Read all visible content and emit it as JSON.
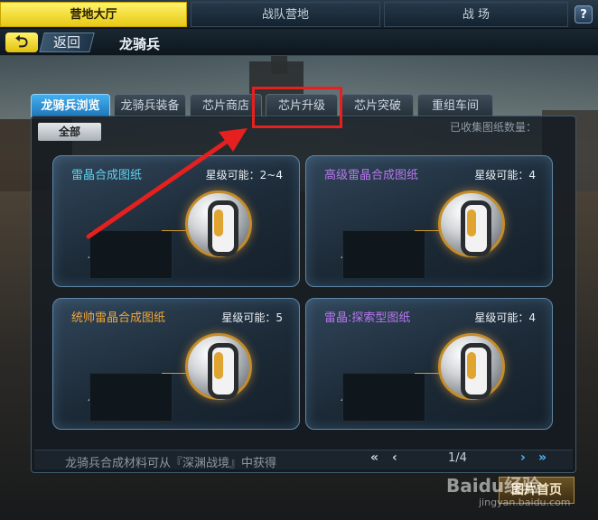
{
  "top_nav": {
    "tabs": [
      "营地大厅",
      "战队营地",
      "战 场"
    ],
    "active_tab": "营地大厅",
    "help_label": "?"
  },
  "header": {
    "back_icon": "back-arrow-icon",
    "back_label": "返回",
    "title": "龙骑兵"
  },
  "tabs": [
    {
      "label": "龙骑兵浏览",
      "active": true
    },
    {
      "label": "龙骑兵装备",
      "active": false
    },
    {
      "label": "芯片商店",
      "active": false
    },
    {
      "label": "芯片升级",
      "active": false
    },
    {
      "label": "芯片突破",
      "active": false
    },
    {
      "label": "重组车间",
      "active": false
    }
  ],
  "filter_label": "全部",
  "collected_label": "已收集图纸数量：",
  "cards": [
    {
      "name": "雷晶合成图纸",
      "name_color": "#5fd3f0",
      "star": "星级可能：2~4"
    },
    {
      "name": "高级雷晶合成图纸",
      "name_color": "#b977f0",
      "star": "星级可能：4"
    },
    {
      "name": "统帅雷晶合成图纸",
      "name_color": "#f0a53a",
      "star": "星级可能：5"
    },
    {
      "name": "雷晶:探索型图纸",
      "name_color": "#b977f0",
      "star": "星级可能：4"
    }
  ],
  "footer": {
    "hint": "龙骑兵合成材料可从『深渊战境』中获得",
    "first_label": "«",
    "prev_label": "‹",
    "page": "1/4",
    "next_label": "›",
    "last_label": "»"
  },
  "library_button": "图片首页",
  "watermark": "Baidu经验",
  "watermark_url": "jingyan.baidu.com",
  "annotation_color": "#e5201e"
}
